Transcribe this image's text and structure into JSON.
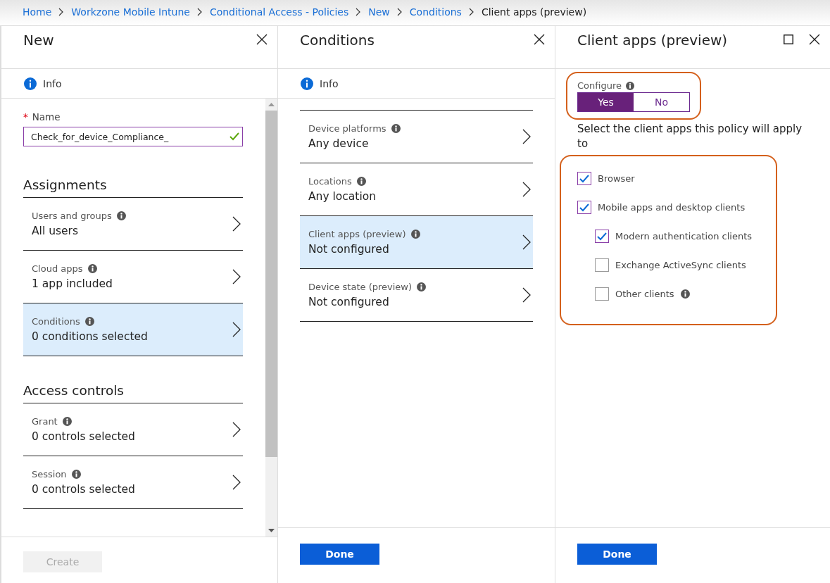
{
  "breadcrumb": [
    {
      "label": "Home",
      "kind": "link"
    },
    {
      "label": "Workzone Mobile Intune",
      "kind": "link"
    },
    {
      "label": "Conditional Access - Policies",
      "kind": "link"
    },
    {
      "label": "New",
      "kind": "link"
    },
    {
      "label": "Conditions",
      "kind": "link"
    },
    {
      "label": "Client apps (preview)",
      "kind": "current"
    }
  ],
  "new_pane": {
    "title": "New",
    "info": "Info",
    "name_label": "Name",
    "required_mark": "*",
    "name_value": "Check_for_device_Compliance_",
    "valid": true,
    "sections": [
      {
        "heading": "Assignments",
        "items": [
          {
            "label": "Users and groups",
            "value": "All users",
            "selected": false
          },
          {
            "label": "Cloud apps",
            "value": "1 app included",
            "selected": false
          },
          {
            "label": "Conditions",
            "value": "0 conditions selected",
            "selected": true
          }
        ]
      },
      {
        "heading": "Access controls",
        "items": [
          {
            "label": "Grant",
            "value": "0 controls selected",
            "selected": false
          },
          {
            "label": "Session",
            "value": "0 controls selected",
            "selected": false
          }
        ]
      }
    ],
    "create_button": {
      "label": "Create",
      "disabled": true
    }
  },
  "conditions_pane": {
    "title": "Conditions",
    "info": "Info",
    "items": [
      {
        "label": "Device platforms",
        "value": "Any device",
        "selected": false
      },
      {
        "label": "Locations",
        "value": "Any location",
        "selected": false
      },
      {
        "label": "Client apps (preview)",
        "value": "Not configured",
        "selected": true
      },
      {
        "label": "Device state (preview)",
        "value": "Not configured",
        "selected": false
      }
    ],
    "done_button": "Done"
  },
  "client_apps_pane": {
    "title": "Client apps (preview)",
    "configure": {
      "label": "Configure",
      "highlighted": true,
      "options": [
        {
          "label": "Yes",
          "selected": true
        },
        {
          "label": "No",
          "selected": false
        }
      ]
    },
    "prompt": "Select the client apps this policy will apply to",
    "client_apps": {
      "highlighted": true,
      "items": [
        {
          "label": "Browser",
          "checked": true,
          "info": false
        },
        {
          "label": "Mobile apps and desktop clients",
          "checked": true,
          "info": false,
          "children": [
            {
              "label": "Modern authentication clients",
              "checked": true,
              "info": false
            },
            {
              "label": "Exchange ActiveSync clients",
              "checked": false,
              "info": false
            },
            {
              "label": "Other clients",
              "checked": false,
              "info": true
            }
          ]
        }
      ]
    },
    "done_button": "Done"
  }
}
